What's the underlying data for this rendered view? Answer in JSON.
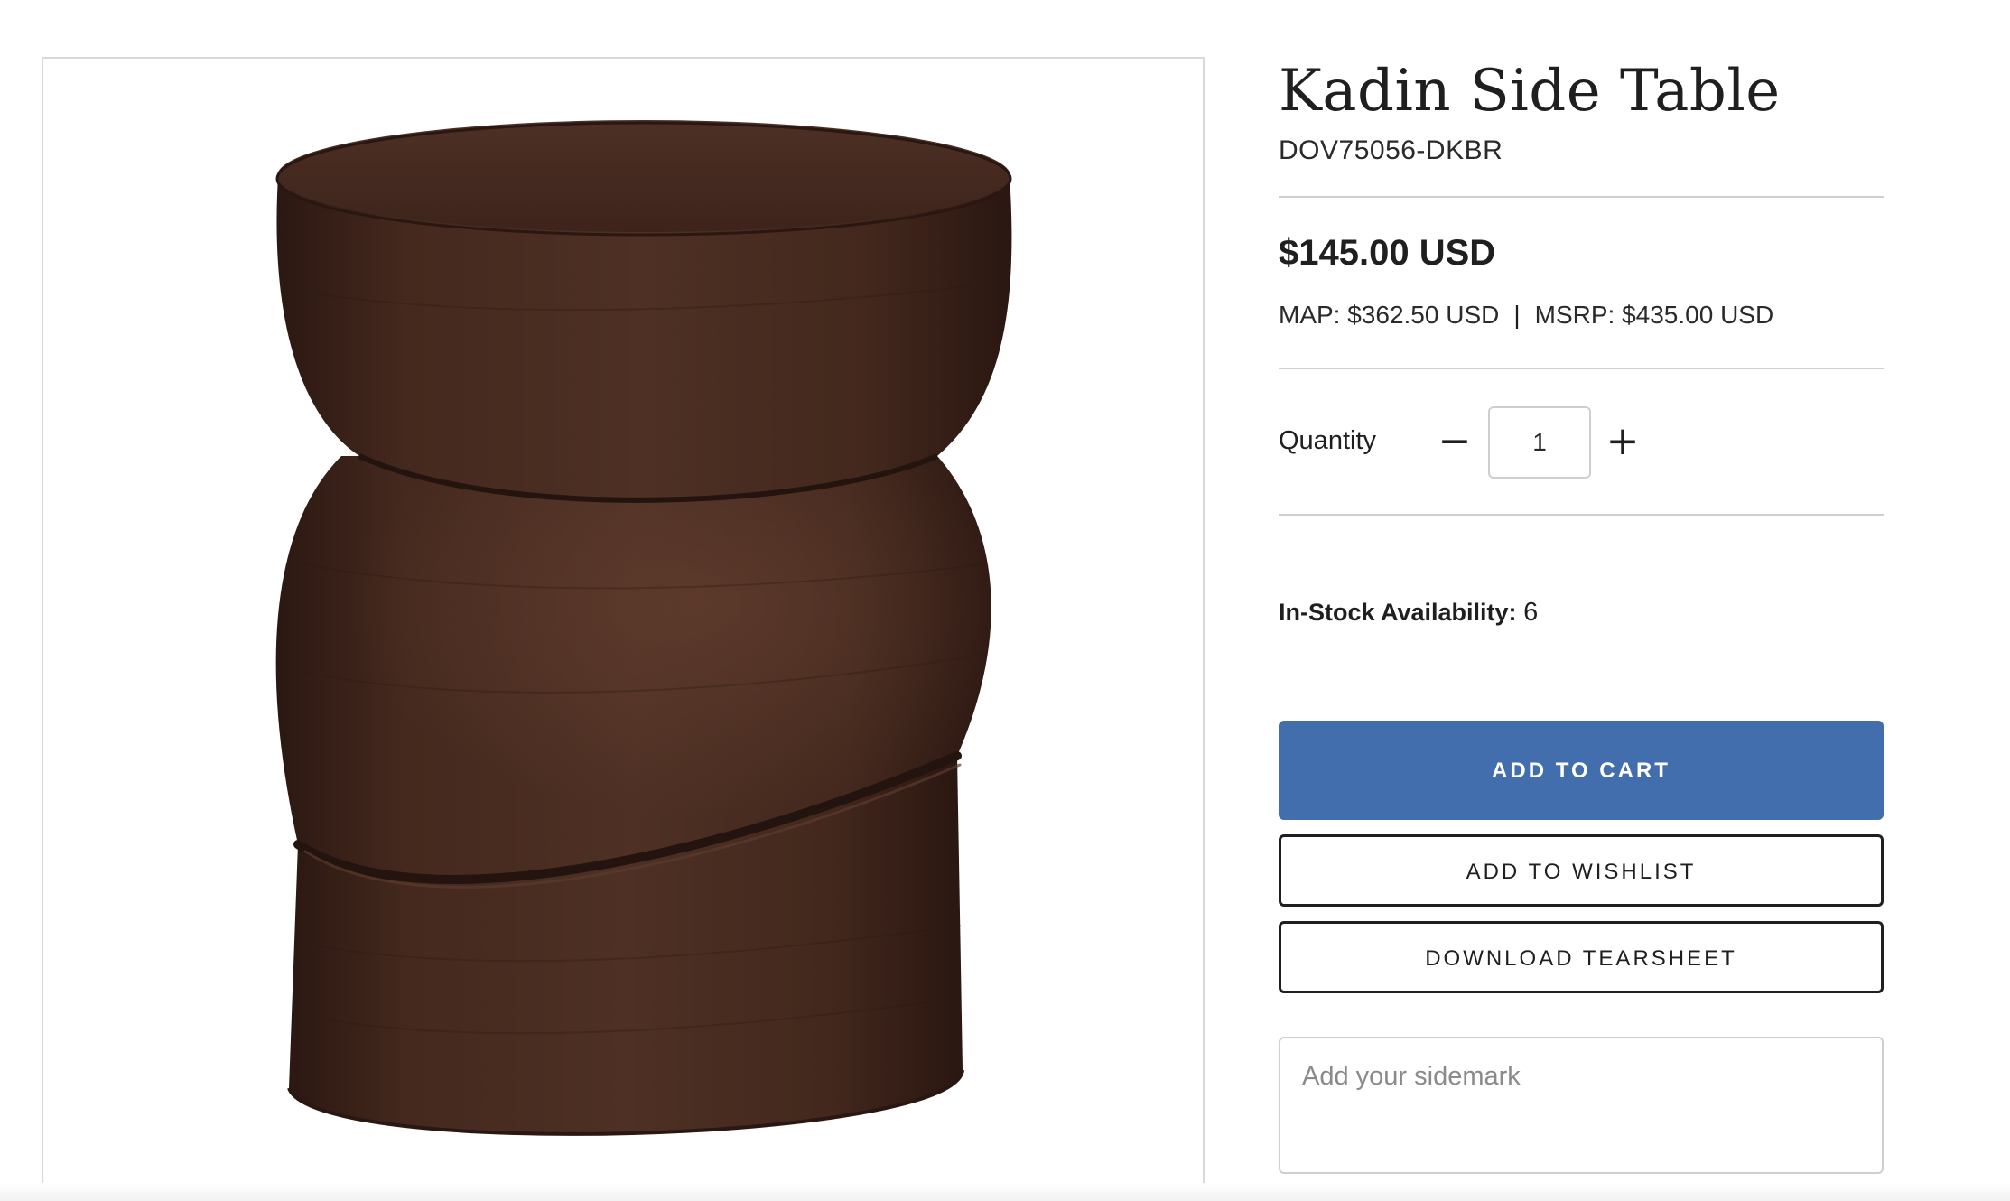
{
  "product": {
    "title": "Kadin Side Table",
    "sku": "DOV75056-DKBR",
    "price": "$145.00 USD",
    "map": "MAP: $362.50 USD",
    "separator": "|",
    "msrp": "MSRP: $435.00 USD"
  },
  "quantity": {
    "label": "Quantity",
    "decrement_symbol": "−",
    "value": "1",
    "increment_symbol": "+"
  },
  "stock": {
    "label": "In-Stock Availability:",
    "count": "6"
  },
  "actions": {
    "add_to_cart": "ADD TO CART",
    "add_to_wishlist": "ADD TO WISHLIST",
    "download_tearsheet": "DOWNLOAD TEARSHEET"
  },
  "sidemark": {
    "placeholder": "Add your sidemark",
    "value": ""
  },
  "colors": {
    "primary_button": "#436eae",
    "wood_dark": "#3a2219",
    "wood_mid": "#4a2c20"
  }
}
